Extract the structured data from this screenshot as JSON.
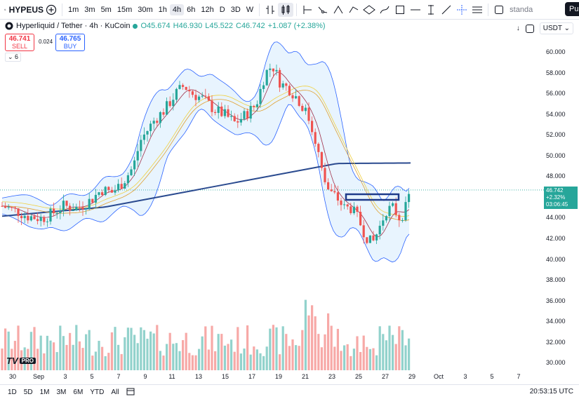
{
  "toolbar": {
    "symbol": "HYPEUS",
    "intervals": [
      "1m",
      "3m",
      "5m",
      "15m",
      "30m",
      "1h",
      "4h",
      "6h",
      "12h",
      "D",
      "3D",
      "W"
    ],
    "active_interval": "4h",
    "scale_label": "standa",
    "publish_label": "Pu"
  },
  "legend": {
    "title": "Hyperliquid / Tether · 4h · KuCoin",
    "open": "O45.674",
    "high": "H46.930",
    "low": "L45.522",
    "close": "C46.742",
    "change": "+1.087 (+2.38%)"
  },
  "trade": {
    "sell_price": "46.741",
    "sell_label": "SELL",
    "spread": "0.024",
    "buy_price": "46.765",
    "buy_label": "BUY"
  },
  "indicators_toggle": "6",
  "currency": "USDT",
  "current_price": {
    "price": "46.742",
    "change": "+2.32%",
    "countdown": "03:06:45"
  },
  "price_axis": [
    "60.000",
    "58.000",
    "56.000",
    "54.000",
    "52.000",
    "50.000",
    "48.000",
    "46.000",
    "44.000",
    "42.000",
    "40.000",
    "38.000",
    "36.000",
    "34.000",
    "32.000",
    "30.000"
  ],
  "time_axis": [
    "30",
    "Sep",
    "3",
    "5",
    "7",
    "9",
    "11",
    "13",
    "15",
    "17",
    "19",
    "21",
    "23",
    "25",
    "27",
    "29",
    "Oct",
    "3",
    "5",
    "7"
  ],
  "ranges": [
    "1D",
    "5D",
    "1M",
    "3M",
    "6M",
    "YTD",
    "All"
  ],
  "clock": "20:53:15 UTC",
  "colors": {
    "up": "#26a69a",
    "down": "#ef5350",
    "band": "#2962ff",
    "ma_long": "#2a4a8f",
    "ma_mid": "#e0a030",
    "ma_short": "#f0d040",
    "ma_red": "#a0304a"
  },
  "logo": {
    "mark": "TV",
    "badge": "PRO"
  }
}
